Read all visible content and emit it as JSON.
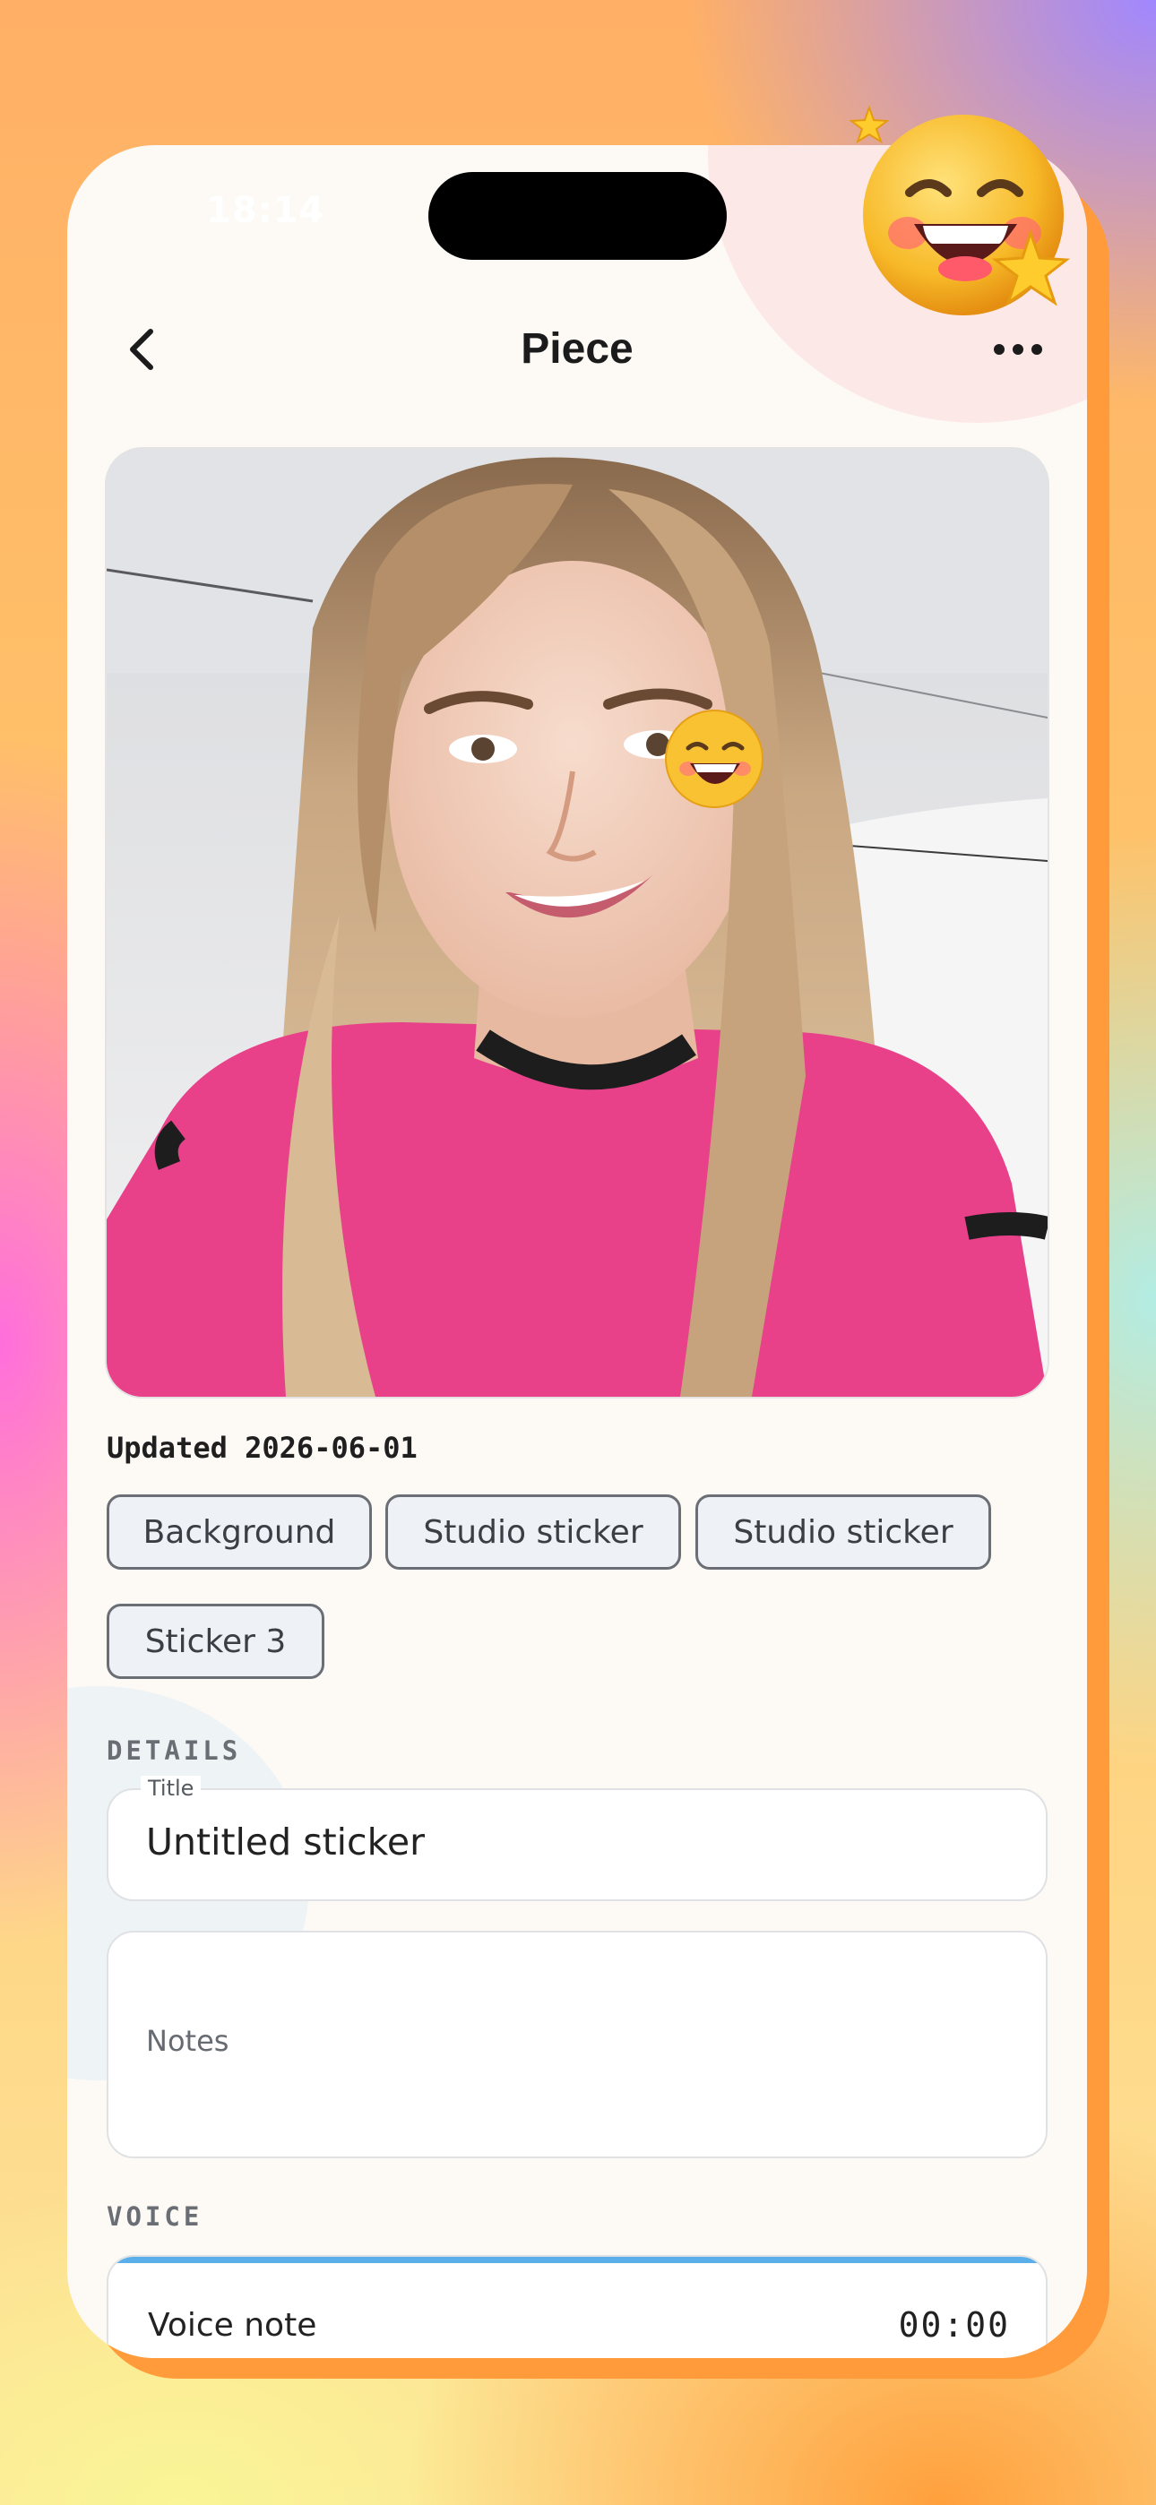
{
  "status_bar": {
    "time": "18:14"
  },
  "nav": {
    "title": "Piece",
    "back_icon": "chevron-left-icon",
    "more_icon": "more-horizontal-icon"
  },
  "photo": {
    "description_icon": "emoji-grin-sticker"
  },
  "meta": {
    "updated": "Updated 2026-06-01"
  },
  "tags": [
    "Background",
    "Studio sticker",
    "Studio sticker",
    "Sticker 3"
  ],
  "details": {
    "section_label": "DETAILS",
    "title_label": "Title",
    "title_value": "Untitled sticker",
    "notes_placeholder": "Notes"
  },
  "voice": {
    "section_label": "VOICE",
    "label": "Voice note",
    "time": "00:00",
    "accent": "#5aaeea"
  },
  "colors": {
    "accent_orange": "#ff9b3a",
    "chip_bg": "#eef1f5",
    "card_bg": "#fdfaf6"
  }
}
